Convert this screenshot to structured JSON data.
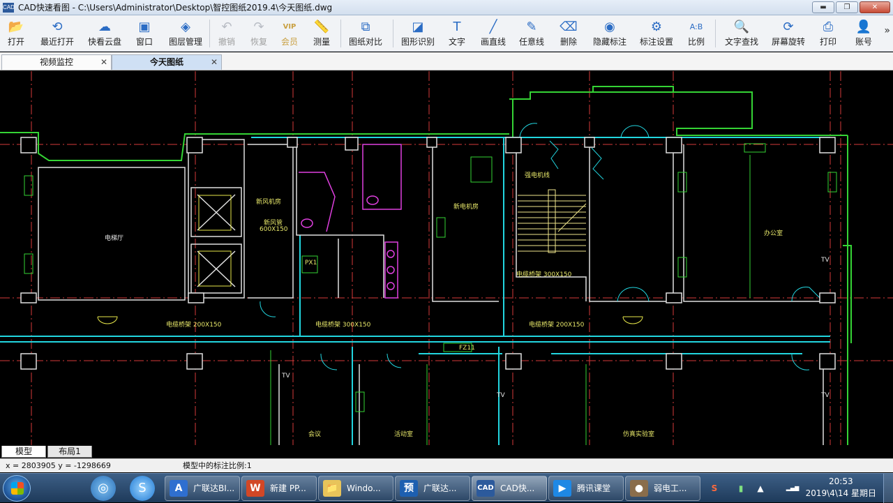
{
  "window": {
    "title": "CAD快速看图 - C:\\Users\\Administrator\\Desktop\\智控图纸2019.4\\今天图纸.dwg",
    "app_icon": "CAD",
    "buttons": {
      "minimize": "▬",
      "restore": "❐",
      "close": "✕"
    }
  },
  "toolbar": {
    "items": [
      {
        "label": "打开",
        "icon": "folder-open-icon",
        "glyph": "📂",
        "enabled": true
      },
      {
        "label": "最近打开",
        "icon": "clock-history-icon",
        "glyph": "⟲",
        "enabled": true
      },
      {
        "label": "快看云盘",
        "icon": "cloud-icon",
        "glyph": "☁",
        "enabled": true
      },
      {
        "label": "窗口",
        "icon": "window-icon",
        "glyph": "▣",
        "enabled": true
      },
      {
        "label": "图层管理",
        "icon": "layers-icon",
        "glyph": "◈",
        "enabled": true
      },
      {
        "label": "撤销",
        "icon": "undo-icon",
        "glyph": "↶",
        "enabled": false
      },
      {
        "label": "恢复",
        "icon": "redo-icon",
        "glyph": "↷",
        "enabled": false
      },
      {
        "label": "会员",
        "icon": "vip-icon",
        "glyph": "VIP",
        "enabled": true
      },
      {
        "label": "测量",
        "icon": "ruler-icon",
        "glyph": "📏",
        "enabled": true
      },
      {
        "label": "图纸对比",
        "icon": "compare-icon",
        "glyph": "⧉",
        "enabled": true
      },
      {
        "label": "图形识别",
        "icon": "shape-recognition-icon",
        "glyph": "◪",
        "enabled": true
      },
      {
        "label": "文字",
        "icon": "text-icon",
        "glyph": "T",
        "enabled": true
      },
      {
        "label": "画直线",
        "icon": "line-icon",
        "glyph": "╱",
        "enabled": true
      },
      {
        "label": "任意线",
        "icon": "pen-icon",
        "glyph": "✎",
        "enabled": true
      },
      {
        "label": "删除",
        "icon": "eraser-icon",
        "glyph": "⌫",
        "enabled": true
      },
      {
        "label": "隐藏标注",
        "icon": "eye-hide-icon",
        "glyph": "◉",
        "enabled": true
      },
      {
        "label": "标注设置",
        "icon": "settings-icon",
        "glyph": "⚙",
        "enabled": true
      },
      {
        "label": "比例",
        "icon": "scale-icon",
        "glyph": "A:B",
        "enabled": true
      },
      {
        "label": "文字查找",
        "icon": "text-search-icon",
        "glyph": "🔍",
        "enabled": true
      },
      {
        "label": "屏幕旋转",
        "icon": "rotate-screen-icon",
        "glyph": "⟳",
        "enabled": true
      },
      {
        "label": "打印",
        "icon": "printer-icon",
        "glyph": "⎙",
        "enabled": true
      },
      {
        "label": "账号",
        "icon": "user-icon",
        "glyph": "👤",
        "enabled": true
      }
    ],
    "overflow": "»"
  },
  "tabs": [
    {
      "label": "视频监控",
      "active": false,
      "close": "✕"
    },
    {
      "label": "今天图纸",
      "active": true,
      "close": "✕"
    }
  ],
  "drawing": {
    "room_labels": [
      {
        "text": "电梯厅",
        "color": "w"
      },
      {
        "text": "新风机房",
        "color": "y"
      },
      {
        "text": "新电机房",
        "color": "y"
      },
      {
        "text": "强电机线",
        "color": "y"
      },
      {
        "text": "办公室",
        "color": "y"
      },
      {
        "text": "新风管",
        "color": "y"
      },
      {
        "text": "600X150",
        "color": "y"
      },
      {
        "text": "PX1",
        "color": "y"
      },
      {
        "text": "电缆桥架 300X150",
        "color": "y"
      },
      {
        "text": "电缆桥架 200X150",
        "color": "y"
      },
      {
        "text": "电缆桥架 300X150",
        "color": "y"
      },
      {
        "text": "电缆桥架 200X150",
        "color": "y"
      },
      {
        "text": "FZ11",
        "color": "y"
      },
      {
        "text": "TV",
        "color": "w"
      },
      {
        "text": "TV",
        "color": "w"
      },
      {
        "text": "TV",
        "color": "w"
      },
      {
        "text": "TV",
        "color": "w"
      },
      {
        "text": "会议",
        "color": "y"
      },
      {
        "text": "活动室",
        "color": "y"
      },
      {
        "text": "仿真实验室",
        "color": "y"
      }
    ]
  },
  "layout_tabs": [
    {
      "label": "模型",
      "active": true
    },
    {
      "label": "布局1",
      "active": false
    }
  ],
  "status": {
    "coords": "x = 2803905  y = -1298669",
    "scale_text": "模型中的标注比例:1"
  },
  "taskbar": {
    "pinned": [
      {
        "icon": "browser-icon",
        "glyph": "◎"
      },
      {
        "icon": "sogou-icon",
        "glyph": "S"
      }
    ],
    "tasks": [
      {
        "label": "广联达BI...",
        "icon": "glodon-icon",
        "glyph": "A",
        "color": "#2f6fd0",
        "active": false
      },
      {
        "label": "新建 PP...",
        "icon": "wps-ppt-icon",
        "glyph": "W",
        "color": "#d24726",
        "active": false
      },
      {
        "label": "Windo...",
        "icon": "explorer-folder-icon",
        "glyph": "📁",
        "color": "#e8c45a",
        "active": false
      },
      {
        "label": "广联达...",
        "icon": "glodon-preview-icon",
        "glyph": "预",
        "color": "#1d5fb0",
        "active": false
      },
      {
        "label": "CAD快...",
        "icon": "cad-icon",
        "glyph": "CAD",
        "color": "#2c5a9c",
        "active": true
      },
      {
        "label": "腾讯课堂",
        "icon": "tencent-classroom-icon",
        "glyph": "▶",
        "color": "#1e88e5",
        "active": false
      },
      {
        "label": "弱电工...",
        "icon": "weak-current-icon",
        "glyph": "●",
        "color": "#8a6d4b",
        "active": false
      }
    ],
    "tray": [
      {
        "icon": "input-method-icon",
        "glyph": "S"
      },
      {
        "icon": "battery-icon",
        "glyph": "▮"
      },
      {
        "icon": "tray-expand-icon",
        "glyph": "▲"
      },
      {
        "icon": "network-icon",
        "glyph": "▂▄▆"
      }
    ],
    "time": "20:53",
    "date": "2019\\4\\14 星期日"
  }
}
